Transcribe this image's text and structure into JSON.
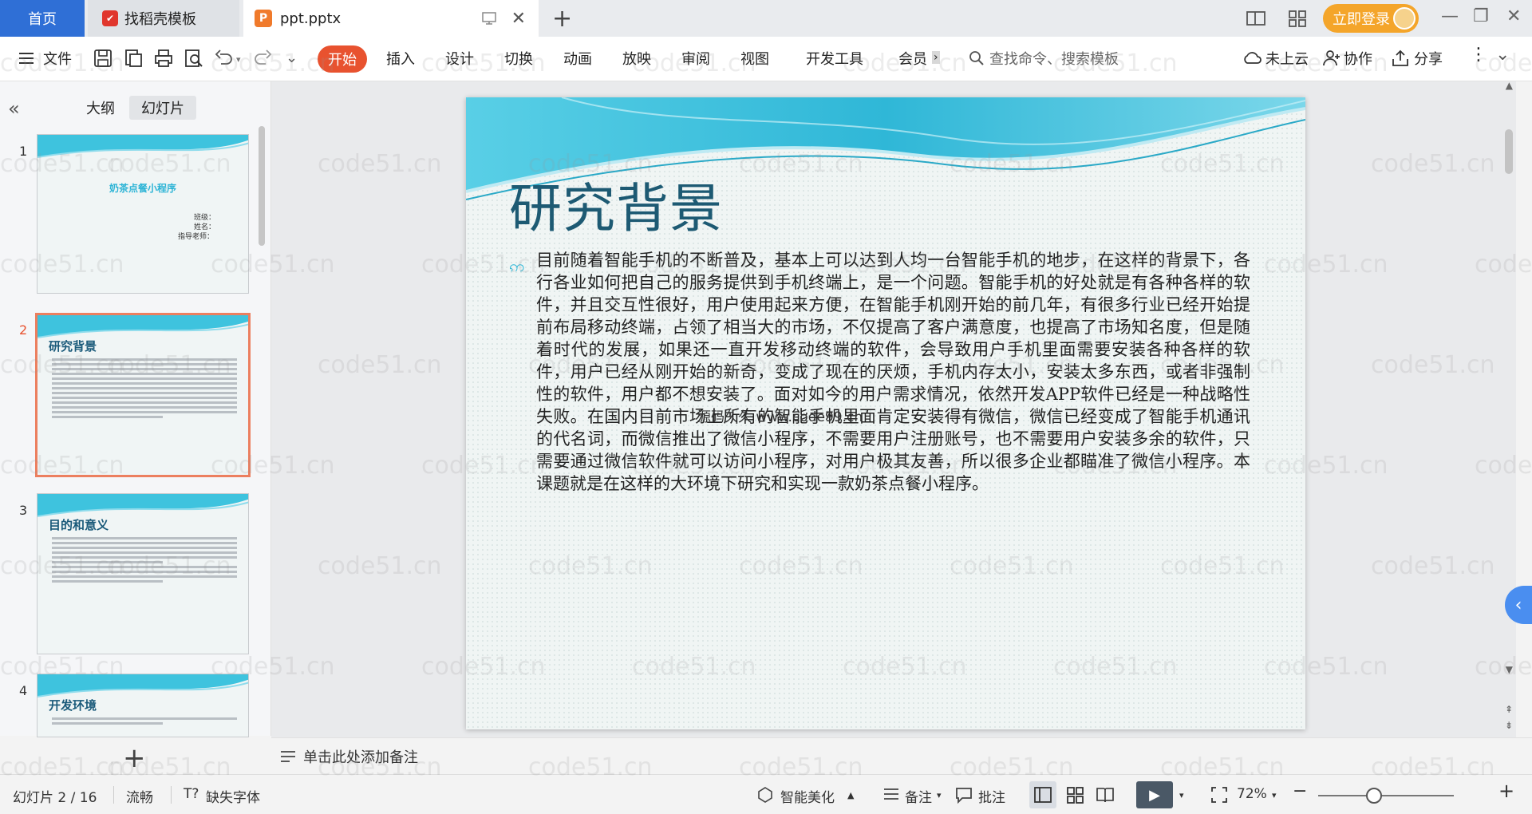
{
  "titlebar": {
    "home_tab": "首页",
    "daoke_tab": "找稻壳模板",
    "doc_tab": "ppt.pptx",
    "login_label": "立即登录"
  },
  "ribbon": {
    "file_label": "文件",
    "tabs": [
      "开始",
      "插入",
      "设计",
      "切换",
      "动画",
      "放映",
      "审阅",
      "视图",
      "开发工具",
      "会员"
    ],
    "search_placeholder": "查找命令、搜索模板",
    "cloud_label": "未上云",
    "collab_label": "协作",
    "share_label": "分享"
  },
  "left_panel": {
    "tabs": [
      "大纲",
      "幻灯片"
    ],
    "thumbnails": [
      {
        "num": "1",
        "title": "奶茶点餐小程序",
        "info": [
          "班级：",
          "姓名：",
          "指导老师："
        ]
      },
      {
        "num": "2",
        "title": "研究背景"
      },
      {
        "num": "3",
        "title": "目的和意义"
      },
      {
        "num": "4",
        "title": "开发环境"
      }
    ]
  },
  "slide": {
    "title": "研究背景",
    "body": "目前随着智能手机的不断普及，基本上可以达到人均一台智能手机的地步，在这样的背景下，各行各业如何把自己的服务提供到手机终端上，是一个问题。智能手机的好处就是有各种各样的软件，并且交互性很好，用户使用起来方便，在智能手机刚开始的前几年，有很多行业已经开始提前布局移动终端，占领了相当大的市场，不仅提高了客户满意度，也提高了市场知名度，但是随着时代的发展，如果还一直开发移动终端的软件，会导致用户手机里面需要安装各种各样的软件，用户已经从刚开始的新奇，变成了现在的厌烦，手机内存太小，安装太多东西，或者非强制性的软件，用户都不想安装了。面对如今的用户需求情况，依然开发APP软件已经是一种战略性失败。在国内目前市场上所有的智能手机里面肯定安装得有微信，微信已经变成了智能手机通讯的代名词，而微信推出了微信小程序，不需要用户注册账号，也不需要用户安装多余的软件，只需要通过微信软件就可以访问小程序，对用户极其友善，所以很多企业都瞄准了微信小程序。本课题就是在这样的大环境下研究和实现一款奶茶点餐小程序。",
    "watermark_text": "源码久久 www.code99.cn"
  },
  "notes": {
    "placeholder": "单击此处添加备注"
  },
  "statusbar": {
    "slide_counter": "幻灯片 2 / 16",
    "smooth": "流畅",
    "missing_font": "缺失字体",
    "smart_beautify": "智能美化",
    "notes": "备注",
    "comment": "批注",
    "zoom": "72%"
  },
  "watermark": "code51.cn",
  "colors": {
    "accent_orange": "#e8522f",
    "home_blue": "#2f6fd6",
    "login_yellow": "#f4a52a",
    "slide_title": "#1d5a73",
    "wave_cyan": "#2db4d6"
  }
}
